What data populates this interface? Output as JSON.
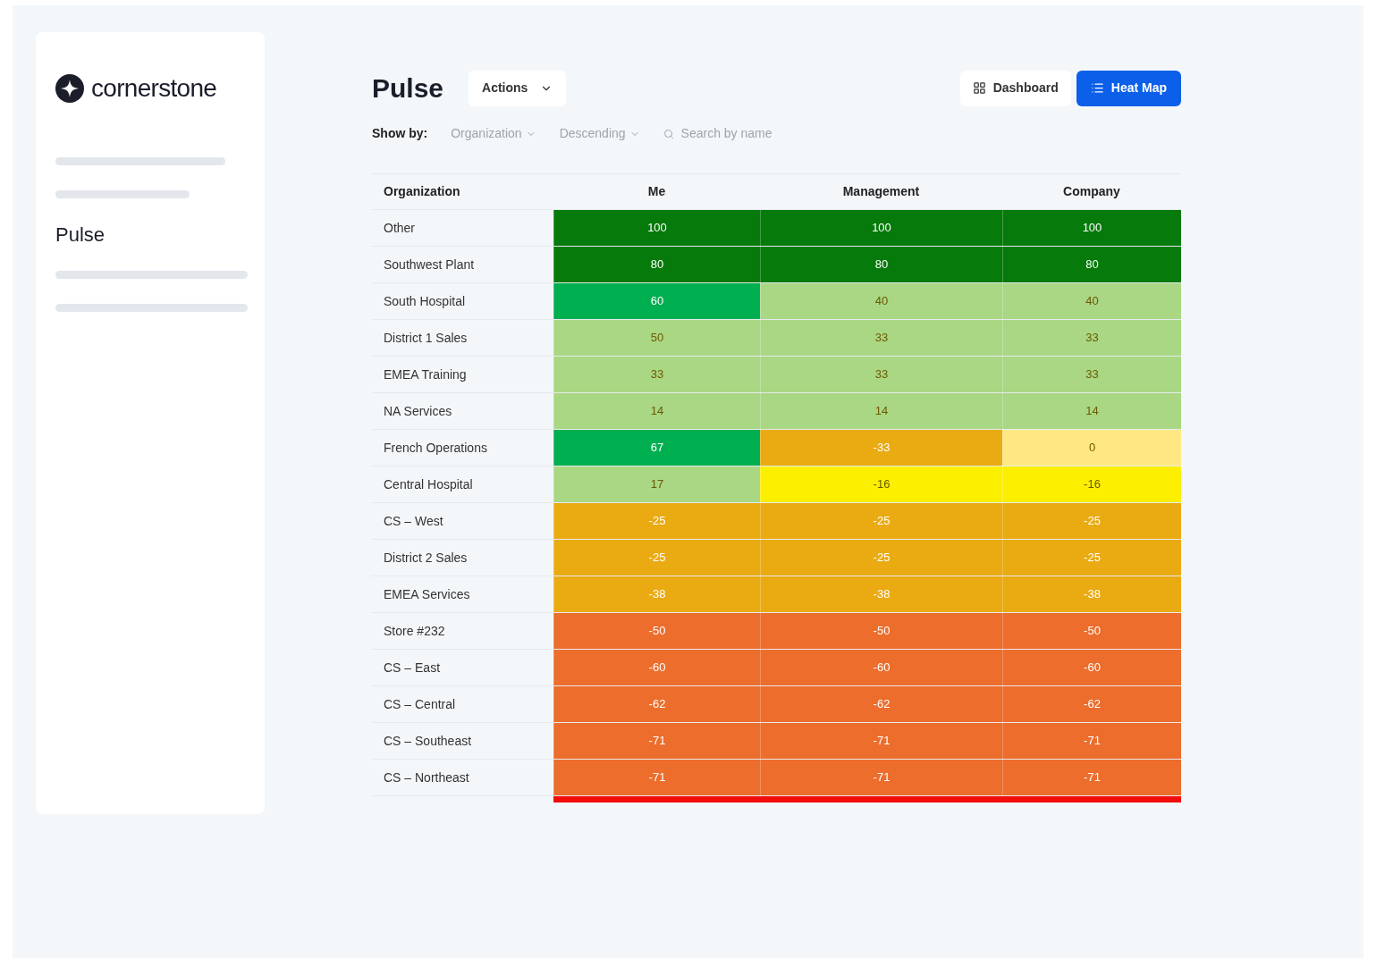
{
  "sidebar": {
    "logo": "cornerstone",
    "items": [
      {
        "kind": "placeholder"
      },
      {
        "kind": "placeholder"
      },
      {
        "kind": "label",
        "label": "Pulse"
      },
      {
        "kind": "placeholder"
      },
      {
        "kind": "placeholder"
      }
    ]
  },
  "header": {
    "title": "Pulse",
    "actions": "Actions",
    "views": [
      {
        "label": "Dashboard",
        "selected": false
      },
      {
        "label": "Heat Map",
        "selected": true
      }
    ]
  },
  "filters": {
    "label": "Show by:",
    "dropdowns": [
      "Organization",
      "Descending"
    ],
    "search": {
      "placeholder": "Search by name"
    }
  },
  "table": {
    "columns": [
      "Organization",
      "Me",
      "Management",
      "Company"
    ],
    "rows": [
      {
        "cells": [
          {
            "value": "Other"
          },
          {
            "value": "100",
            "color": "#067a0a"
          },
          {
            "value": "100",
            "color": "#067a0a"
          },
          {
            "value": "100",
            "color": "#067a0a"
          }
        ]
      },
      {
        "cells": [
          {
            "value": "Southwest Plant"
          },
          {
            "value": "80",
            "color": "#067a0a"
          },
          {
            "value": "80",
            "color": "#067a0a"
          },
          {
            "value": "80",
            "color": "#067a0a"
          }
        ]
      },
      {
        "cells": [
          {
            "value": "South Hospital"
          },
          {
            "value": "60",
            "color": "#00af4f"
          },
          {
            "value": "40",
            "color": "#a9d784"
          },
          {
            "value": "40",
            "color": "#a9d784"
          }
        ]
      },
      {
        "cells": [
          {
            "value": "District 1 Sales"
          },
          {
            "value": "50",
            "color": "#a9d784"
          },
          {
            "value": "33",
            "color": "#a9d784"
          },
          {
            "value": "33",
            "color": "#a9d784"
          }
        ]
      },
      {
        "cells": [
          {
            "value": "EMEA Training"
          },
          {
            "value": "33",
            "color": "#a9d784"
          },
          {
            "value": "33",
            "color": "#a9d784"
          },
          {
            "value": "33",
            "color": "#a9d784"
          }
        ]
      },
      {
        "cells": [
          {
            "value": "NA Services"
          },
          {
            "value": "14",
            "color": "#a9d784"
          },
          {
            "value": "14",
            "color": "#a9d784"
          },
          {
            "value": "14",
            "color": "#a9d784"
          }
        ]
      },
      {
        "cells": [
          {
            "value": "French Operations"
          },
          {
            "value": "67",
            "color": "#00af4f"
          },
          {
            "value": "-33",
            "color": "#eaaa12"
          },
          {
            "value": "0",
            "color": "#ffe884"
          }
        ]
      },
      {
        "cells": [
          {
            "value": "Central Hospital"
          },
          {
            "value": "17",
            "color": "#a9d784"
          },
          {
            "value": "-16",
            "color": "#fcef00"
          },
          {
            "value": "-16",
            "color": "#fcef00"
          }
        ]
      },
      {
        "cells": [
          {
            "value": "CS – West"
          },
          {
            "value": "-25",
            "color": "#eaaa12"
          },
          {
            "value": "-25",
            "color": "#eaaa12"
          },
          {
            "value": "-25",
            "color": "#eaaa12"
          }
        ]
      },
      {
        "cells": [
          {
            "value": "District 2 Sales"
          },
          {
            "value": "-25",
            "color": "#eaaa12"
          },
          {
            "value": "-25",
            "color": "#eaaa12"
          },
          {
            "value": "-25",
            "color": "#eaaa12"
          }
        ]
      },
      {
        "cells": [
          {
            "value": "EMEA Services"
          },
          {
            "value": "-38",
            "color": "#eaaa12"
          },
          {
            "value": "-38",
            "color": "#eaaa12"
          },
          {
            "value": "-38",
            "color": "#eaaa12"
          }
        ]
      },
      {
        "cells": [
          {
            "value": "Store #232"
          },
          {
            "value": "-50",
            "color": "#ec6d2c"
          },
          {
            "value": "-50",
            "color": "#ec6d2c"
          },
          {
            "value": "-50",
            "color": "#ec6d2c"
          }
        ]
      },
      {
        "cells": [
          {
            "value": "CS – East"
          },
          {
            "value": "-60",
            "color": "#ec6d2c"
          },
          {
            "value": "-60",
            "color": "#ec6d2c"
          },
          {
            "value": "-60",
            "color": "#ec6d2c"
          }
        ]
      },
      {
        "cells": [
          {
            "value": "CS – Central"
          },
          {
            "value": "-62",
            "color": "#ec6d2c"
          },
          {
            "value": "-62",
            "color": "#ec6d2c"
          },
          {
            "value": "-62",
            "color": "#ec6d2c"
          }
        ]
      },
      {
        "cells": [
          {
            "value": "CS – Southeast"
          },
          {
            "value": "-71",
            "color": "#ec6d2c"
          },
          {
            "value": "-71",
            "color": "#ec6d2c"
          },
          {
            "value": "-71",
            "color": "#ec6d2c"
          }
        ]
      },
      {
        "cells": [
          {
            "value": "CS – Northeast"
          },
          {
            "value": "-71",
            "color": "#ec6d2c"
          },
          {
            "value": "-71",
            "color": "#ec6d2c"
          },
          {
            "value": "-71",
            "color": "#ec6d2c"
          }
        ]
      }
    ],
    "cut_off_row": {
      "cells": [
        {
          "color": "#f20d0d"
        },
        {
          "color": "#f20d0d"
        },
        {
          "color": "#f20d0d"
        }
      ]
    }
  }
}
